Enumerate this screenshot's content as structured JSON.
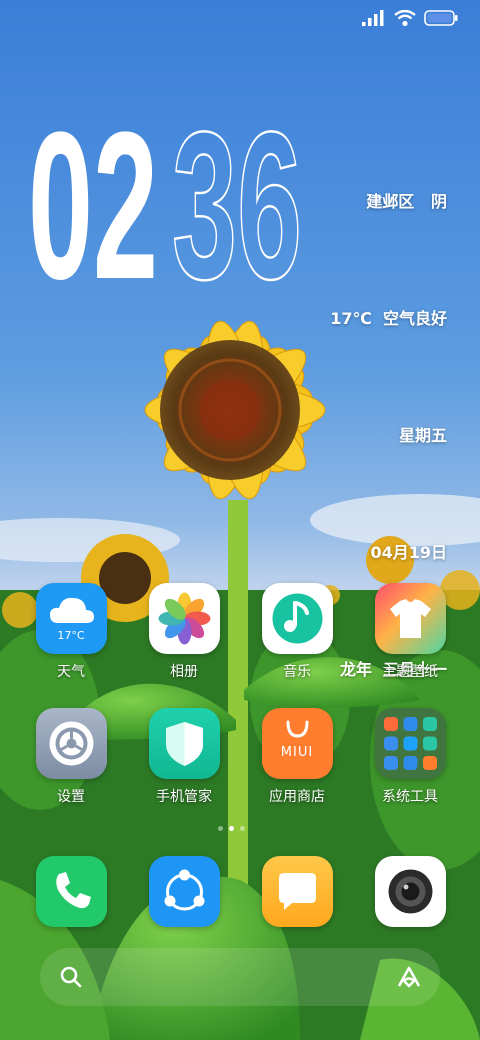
{
  "status": {
    "icons": [
      "signal-icon",
      "wifi-icon",
      "battery-icon"
    ]
  },
  "clock": {
    "hours": "02",
    "minutes": "36"
  },
  "info": {
    "location": "建邺区",
    "weather": "阴",
    "temp_line": "17℃  空气良好",
    "weekday": "星期五",
    "date": "04月19日",
    "lunar": "龙年  三月十一"
  },
  "apps": {
    "weather": {
      "label": "天气",
      "temp": "17°C",
      "icon": "cloud-icon"
    },
    "gallery": {
      "label": "相册",
      "icon": "photos-flower-icon"
    },
    "music": {
      "label": "音乐",
      "icon": "music-note-icon"
    },
    "themes": {
      "label": "主题壁纸",
      "icon": "tshirt-icon"
    },
    "settings": {
      "label": "设置",
      "icon": "gear-icon"
    },
    "security": {
      "label": "手机管家",
      "icon": "shield-icon"
    },
    "appstore": {
      "label": "应用商店",
      "icon_text": "MIUI",
      "icon": "shopping-bag-icon"
    },
    "tools": {
      "label": "系统工具",
      "icon": "folder-icon"
    }
  },
  "dock": {
    "items": [
      "phone-icon",
      "share-icon",
      "message-icon",
      "camera-icon"
    ]
  },
  "colors": {
    "weather_blue": "#1e9af5",
    "music_teal": "#17c3a0",
    "security_teal": "#16c8a6",
    "appstore_orange": "#ff7d2f",
    "phone_green": "#22c96a",
    "share_blue": "#1e96f5",
    "message_yellow": "#ffb42b"
  }
}
